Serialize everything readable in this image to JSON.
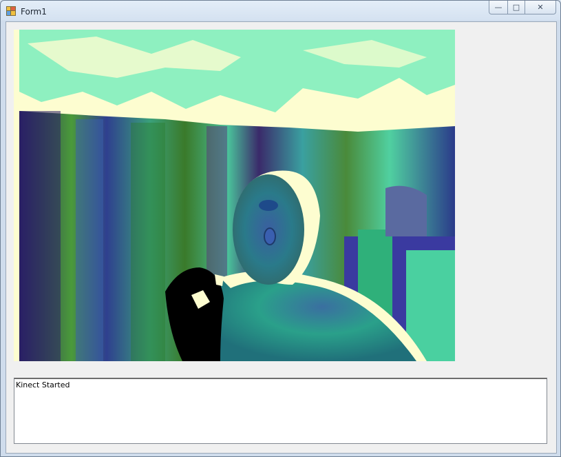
{
  "window": {
    "title": "Form1",
    "icon": "winforms-app-icon",
    "caption_buttons": {
      "minimize_icon": "minimize-icon",
      "maximize_icon": "maximize-icon",
      "close_icon": "close-icon",
      "minimize_glyph": "—",
      "maximize_glyph": "□",
      "close_glyph": "✕"
    }
  },
  "depth_view": {
    "description_icon": "kinect-depth-image",
    "colors": {
      "background": "#fdfdd0",
      "far": "#8ef0c0",
      "wall_dark": "#2a1f66",
      "wall_mid": "#3a8a3a",
      "wall_teal": "#3fb0a0",
      "person": "#2a8a7a",
      "near": "#000000"
    }
  },
  "log": {
    "lines": [
      "Kinect Started"
    ]
  }
}
